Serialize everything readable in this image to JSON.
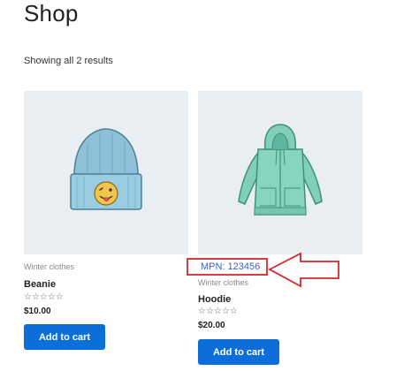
{
  "page": {
    "title": "Shop",
    "result_count": "Showing all 2 results"
  },
  "products": [
    {
      "category": "Winter clothes",
      "name": "Beanie",
      "rating_stars": "☆☆☆☆☆",
      "price": "$10.00",
      "button": "Add to cart",
      "image": "beanie-image"
    },
    {
      "mpn": "MPN: 123456",
      "category": "Winter clothes",
      "name": "Hoodie",
      "rating_stars": "☆☆☆☆☆",
      "price": "$20.00",
      "button": "Add to cart",
      "image": "hoodie-image"
    }
  ],
  "colors": {
    "accent": "#0c6ed8",
    "annotation": "#d7262b",
    "image_bg": "#e8eef2",
    "mpn_text": "#3f63b3"
  }
}
